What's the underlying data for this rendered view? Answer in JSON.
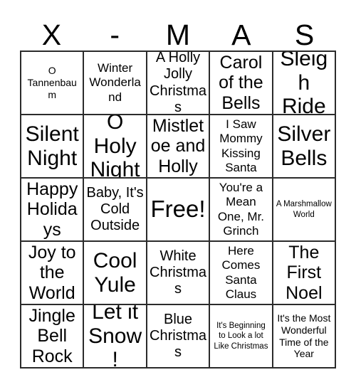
{
  "header": {
    "letters": [
      "X",
      "-",
      "M",
      "A",
      "S"
    ]
  },
  "grid": {
    "rows": [
      [
        {
          "label": "O Tannenbaum",
          "size": "fs-sm"
        },
        {
          "label": "Winter Wonderland",
          "size": "fs-md"
        },
        {
          "label": "A Holly Jolly Christmas",
          "size": "fs-lg"
        },
        {
          "label": "Carol of the Bells",
          "size": "fs-xl"
        },
        {
          "label": "Sleigh Ride",
          "size": "fs-xxl"
        }
      ],
      [
        {
          "label": "Silent Night",
          "size": "fs-xxl"
        },
        {
          "label": "O Holy Night",
          "size": "fs-xxl"
        },
        {
          "label": "Mistletoe and Holly",
          "size": "fs-xl"
        },
        {
          "label": "I Saw Mommy Kissing Santa",
          "size": "fs-md"
        },
        {
          "label": "Silver Bells",
          "size": "fs-xxl"
        }
      ],
      [
        {
          "label": "Happy Holidays",
          "size": "fs-xl"
        },
        {
          "label": "Baby, It's Cold Outside",
          "size": "fs-lg"
        },
        {
          "label": "Free!",
          "size": "fs-free"
        },
        {
          "label": "You're a Mean One, Mr. Grinch",
          "size": "fs-md"
        },
        {
          "label": "A Marshmallow World",
          "size": "fs-xs"
        }
      ],
      [
        {
          "label": "Joy to the World",
          "size": "fs-xl"
        },
        {
          "label": "Cool Yule",
          "size": "fs-xxl"
        },
        {
          "label": "White Christmas",
          "size": "fs-lg"
        },
        {
          "label": "Here Comes Santa Claus",
          "size": "fs-md"
        },
        {
          "label": "The First Noel",
          "size": "fs-xl"
        }
      ],
      [
        {
          "label": "Jingle Bell Rock",
          "size": "fs-xl"
        },
        {
          "label": "Let it Snow!",
          "size": "fs-xxl"
        },
        {
          "label": "Blue Christmas",
          "size": "fs-lg"
        },
        {
          "label": "It's Beginning to Look a lot Like Christmas",
          "size": "fs-xs"
        },
        {
          "label": "It's the Most Wonderful Time of the Year",
          "size": "fs-sm"
        }
      ]
    ]
  },
  "colors": {
    "border": "#2b2b2b",
    "text": "#000000",
    "background": "#ffffff"
  }
}
